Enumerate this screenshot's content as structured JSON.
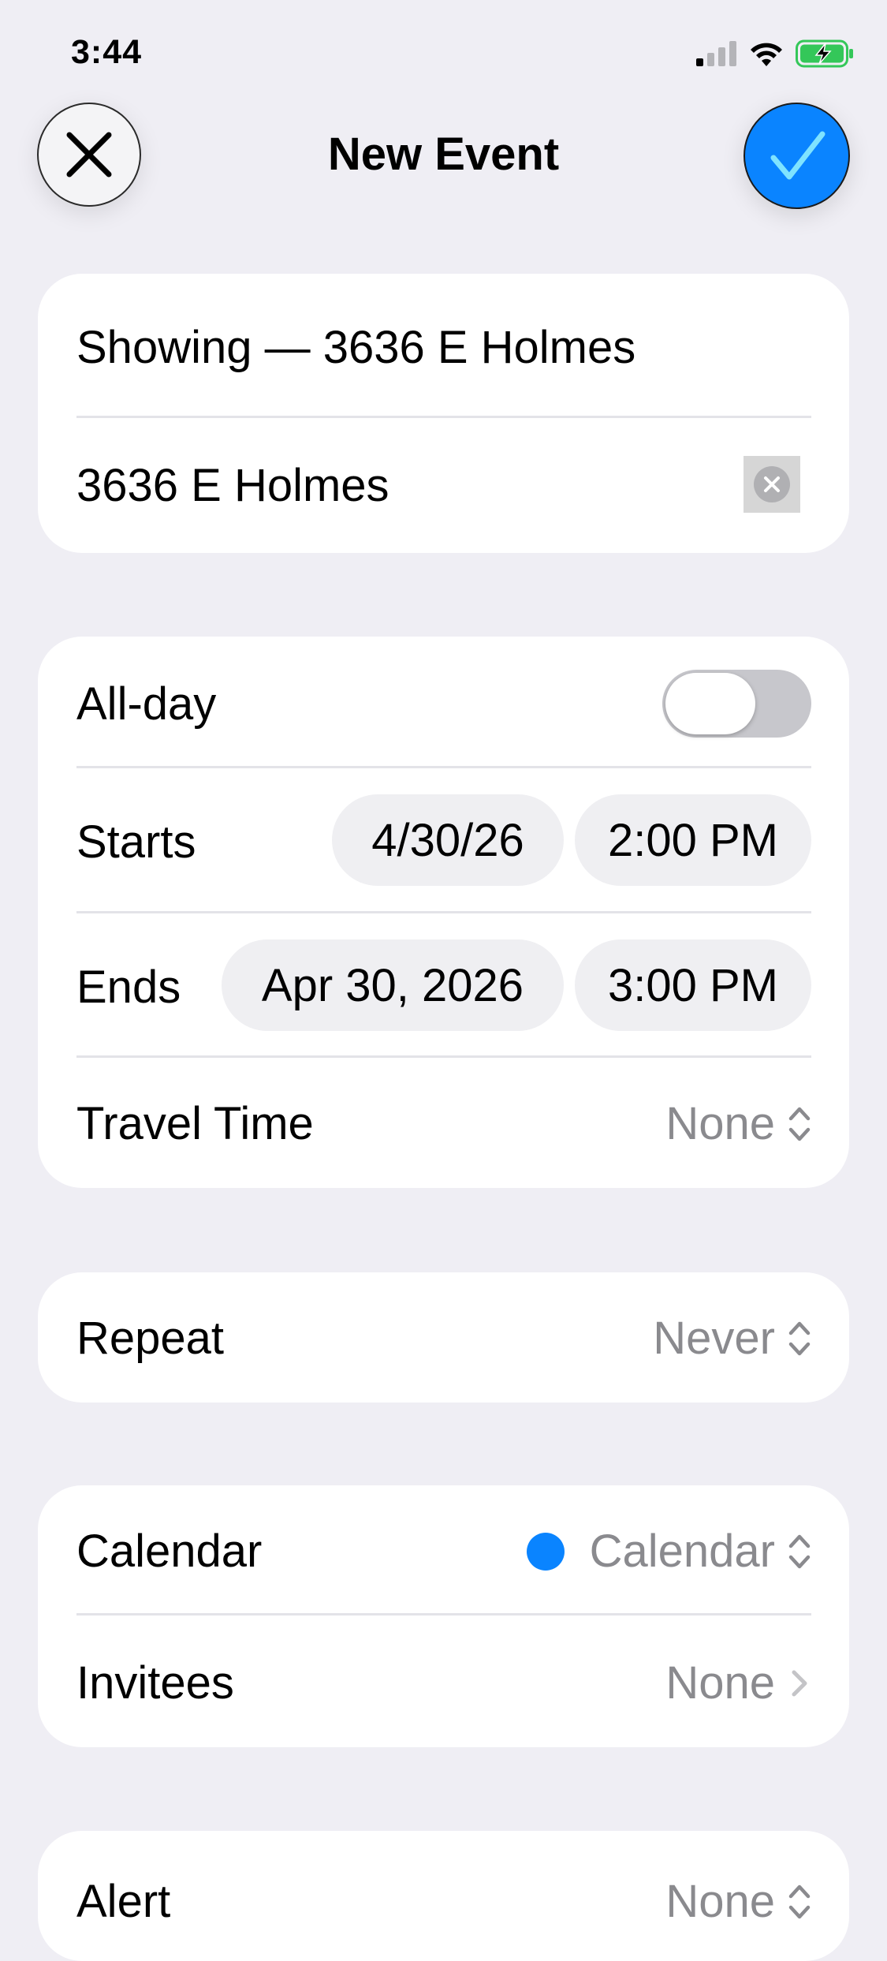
{
  "status_bar": {
    "time": "3:44"
  },
  "nav": {
    "title": "New Event"
  },
  "event": {
    "title": "Showing — 3636 E Holmes",
    "location": "3636 E Holmes"
  },
  "timing": {
    "all_day_label": "All-day",
    "all_day_on": false,
    "starts_label": "Starts",
    "start_date": "4/30/26",
    "start_time": "2:00 PM",
    "ends_label": "Ends",
    "end_date": "Apr 30, 2026",
    "end_time": "3:00 PM",
    "travel_label": "Travel Time",
    "travel_value": "None"
  },
  "repeat": {
    "label": "Repeat",
    "value": "Never"
  },
  "calendar": {
    "label": "Calendar",
    "value": "Calendar",
    "color": "#0A84FF",
    "invitees_label": "Invitees",
    "invitees_value": "None"
  },
  "alert": {
    "label": "Alert",
    "value": "None"
  },
  "colors": {
    "accent": "#0A84FF",
    "background": "#EFEEF4",
    "secondary_text": "#8A8A8E"
  }
}
